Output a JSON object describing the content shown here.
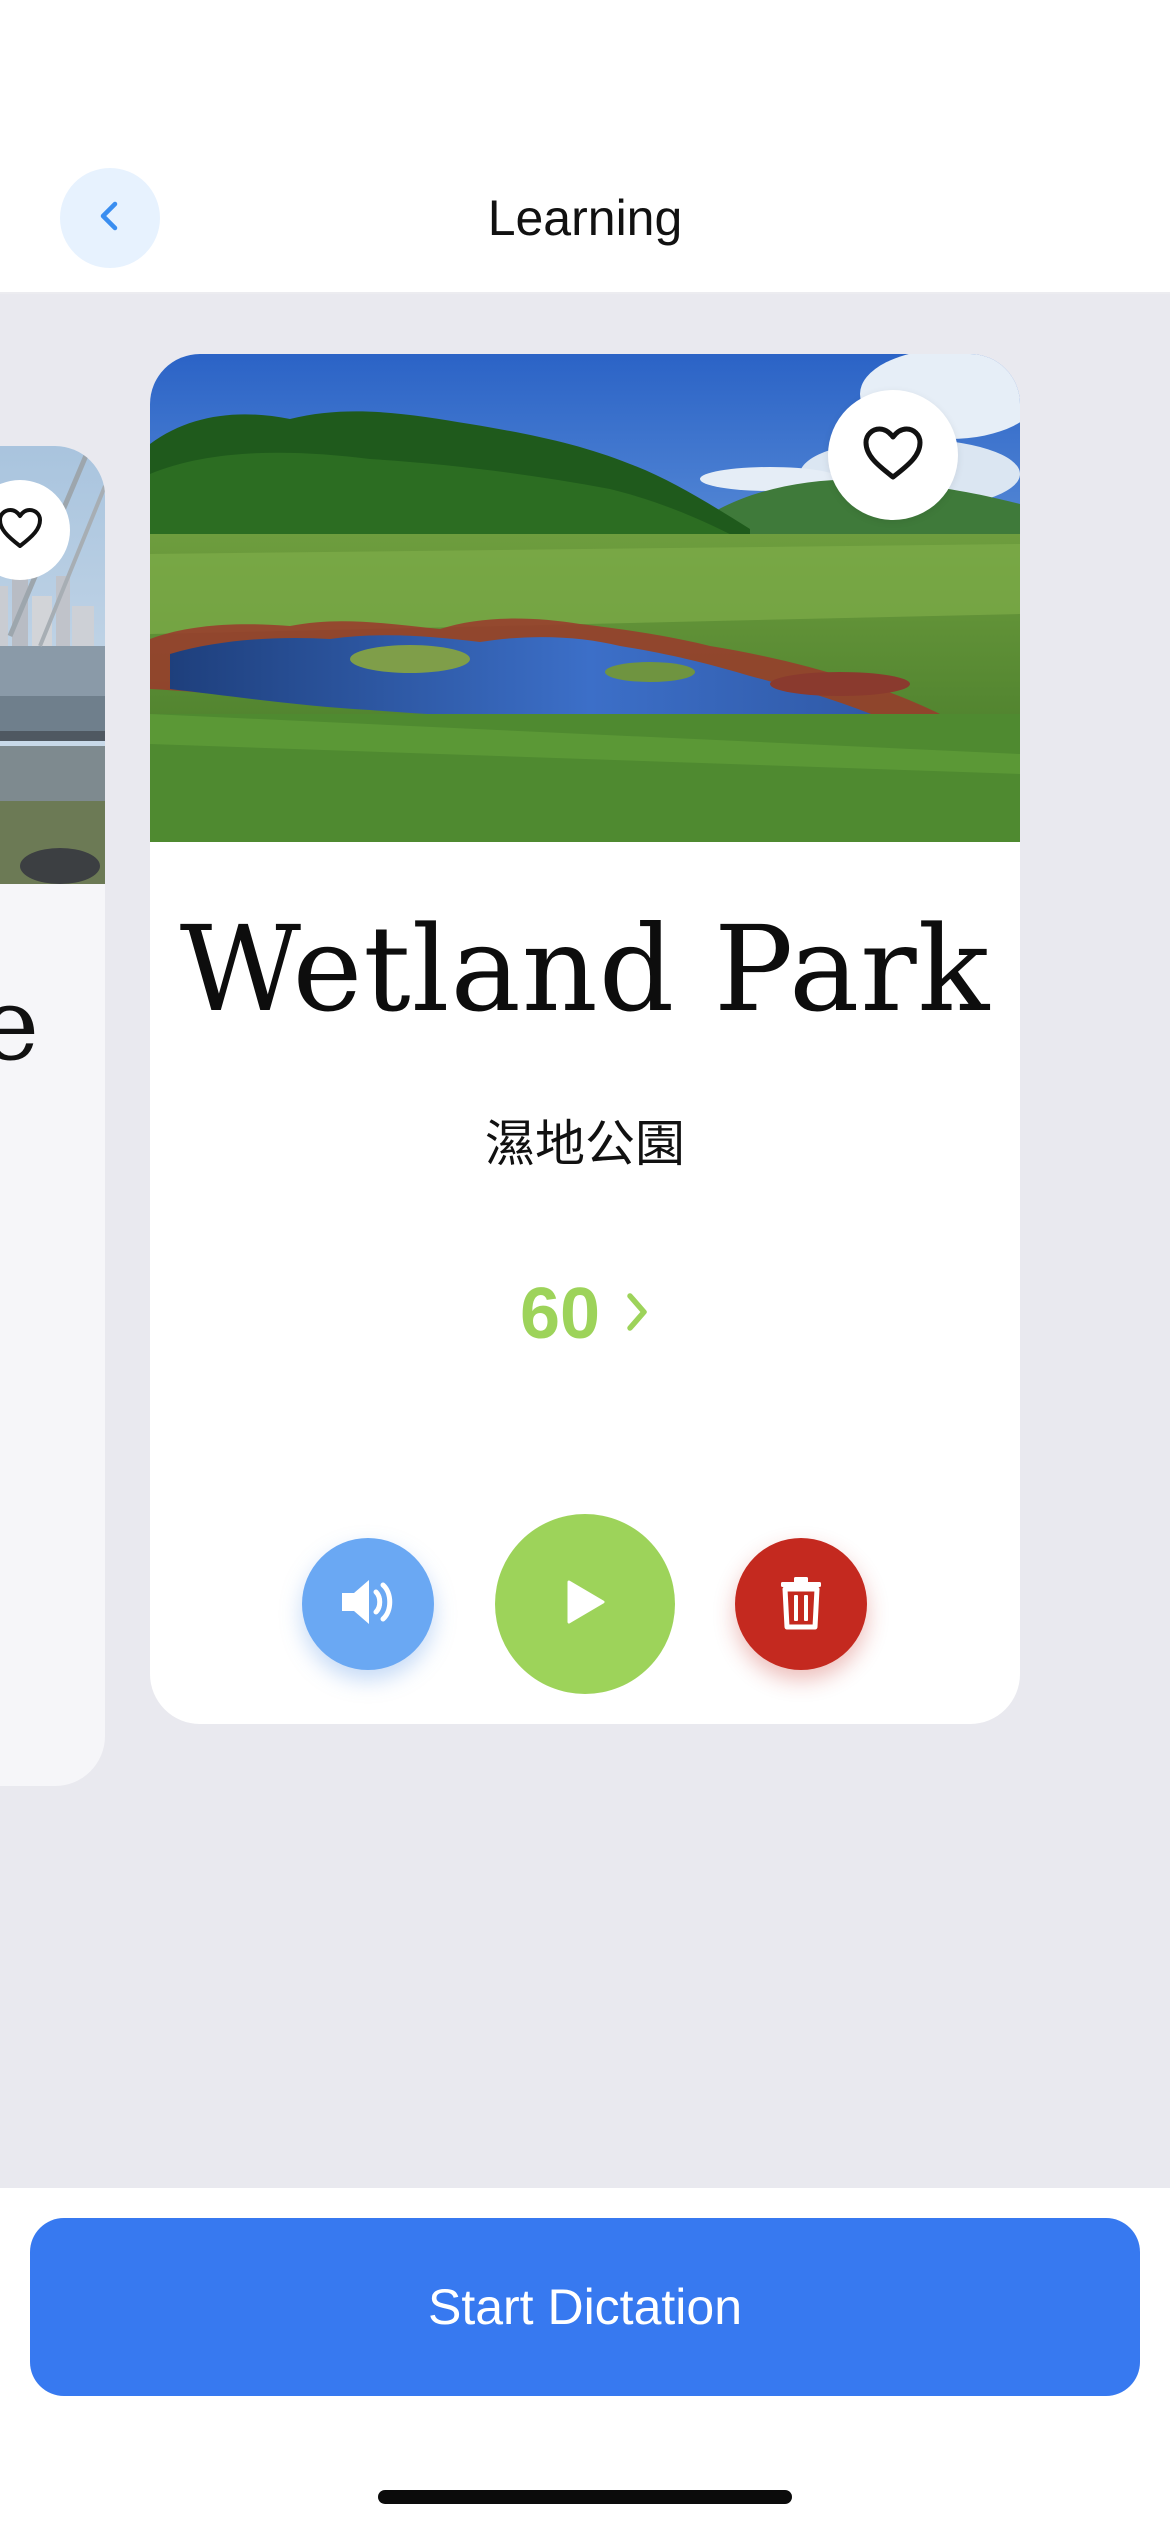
{
  "header": {
    "title": "Learning",
    "back_icon": "chevron-left-icon"
  },
  "colors": {
    "accent_blue": "#3779f0",
    "speaker_blue": "#6aa8f3",
    "green": "#9dd35a",
    "delete_red": "#c4291f",
    "content_bg": "#e9e9ef"
  },
  "previous_card": {
    "partial_title": "e",
    "favorite_icon": "heart-outline-icon",
    "image_icon": "city-skyline-photo"
  },
  "card": {
    "image_icon": "wetland-landscape-photo",
    "favorite_icon": "heart-outline-icon",
    "word": "Wetland Park",
    "translation": "濕地公園",
    "score": "60",
    "score_icon": "chevron-right-icon",
    "controls": [
      {
        "icon": "speaker-icon"
      },
      {
        "icon": "play-icon"
      },
      {
        "icon": "trash-icon"
      }
    ]
  },
  "footer": {
    "start_label": "Start Dictation"
  }
}
